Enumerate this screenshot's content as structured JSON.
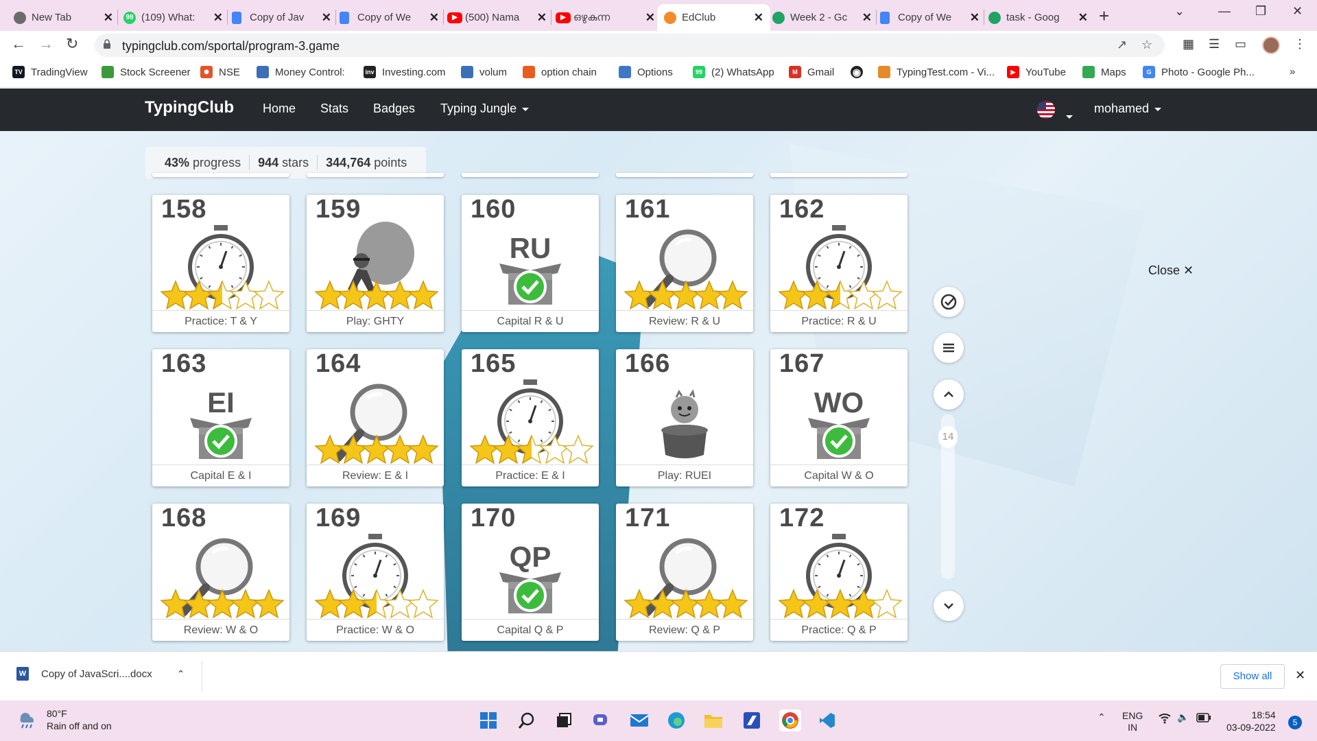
{
  "browser": {
    "tabs": [
      {
        "title": "New Tab",
        "icon": "chrome-icon",
        "color": "#6b6b6b"
      },
      {
        "title": "(109) What:",
        "icon": "whatsapp-icon",
        "color": "#25d366"
      },
      {
        "title": "Copy of Jav",
        "icon": "google-docs-icon",
        "color": "#4285f4"
      },
      {
        "title": "Copy of We",
        "icon": "google-docs-icon",
        "color": "#4285f4"
      },
      {
        "title": "(500) Nama",
        "icon": "youtube-icon",
        "color": "#ff0000"
      },
      {
        "title": "ഒഴുകുന്ന",
        "icon": "youtube-icon",
        "color": "#ff0000"
      },
      {
        "title": "EdClub",
        "icon": "edclub-icon",
        "color": "#f28c28"
      },
      {
        "title": "Week 2 - Gc",
        "icon": "google-drive-icon",
        "color": "#1fa463"
      },
      {
        "title": "Copy of We",
        "icon": "google-docs-icon",
        "color": "#4285f4"
      },
      {
        "title": "task - Goog",
        "icon": "google-drive-icon",
        "color": "#1fa463"
      }
    ],
    "active_tab": 6,
    "url": "typingclub.com/sportal/program-3.game",
    "bookmarks": [
      {
        "label": "TradingView",
        "icon": "tradingview-icon",
        "color": "#131722"
      },
      {
        "label": "Stock Screener",
        "icon": "bar-chart-icon",
        "color": "#3c9a3c"
      },
      {
        "label": "NSE",
        "icon": "nse-icon",
        "color": "#e2542b"
      },
      {
        "label": "Money Control:",
        "icon": "moneycontrol-icon",
        "color": "#3d6fb6"
      },
      {
        "label": "Investing.com",
        "icon": "investing-icon",
        "color": "#222222"
      },
      {
        "label": "volum",
        "icon": "volume-icon",
        "color": "#3d6fb6"
      },
      {
        "label": "option chain",
        "icon": "flame-icon",
        "color": "#e95b1f"
      },
      {
        "label": "Options",
        "icon": "options-icon",
        "color": "#3e77c8"
      },
      {
        "label": "(2) WhatsApp",
        "icon": "whatsapp-icon",
        "color": "#25d366"
      },
      {
        "label": "Gmail",
        "icon": "gmail-icon",
        "color": "#d93025"
      },
      {
        "label": "",
        "icon": "globe-icon",
        "color": "#222222"
      },
      {
        "label": "TypingTest.com - Vi...",
        "icon": "typingtest-icon",
        "color": "#e58a2b"
      },
      {
        "label": "YouTube",
        "icon": "youtube-icon",
        "color": "#ff0000"
      },
      {
        "label": "Maps",
        "icon": "maps-icon",
        "color": "#34a853"
      },
      {
        "label": "Photo - Google Ph...",
        "icon": "google-icon",
        "color": "#4285f4"
      }
    ]
  },
  "site": {
    "brand": "TypingClub",
    "nav": [
      "Home",
      "Stats",
      "Badges",
      "Typing Jungle"
    ],
    "user": "mohamed",
    "progress": {
      "percent": "43%",
      "percent_label": "progress",
      "stars": "944",
      "stars_label": "stars",
      "points": "344,764",
      "points_label": "points"
    },
    "close_label": "Close",
    "scroll_page": "14"
  },
  "lessons": [
    {
      "num": "158",
      "type": "stopwatch",
      "stars": 2.5,
      "label": "Practice: T & Y"
    },
    {
      "num": "159",
      "type": "play-balloon",
      "stars": 5,
      "label": "Play: GHTY"
    },
    {
      "num": "160",
      "type": "capital",
      "letters": "RU",
      "stars": 0,
      "label": "Capital R & U"
    },
    {
      "num": "161",
      "type": "magnifier",
      "stars": 5,
      "label": "Review: R & U"
    },
    {
      "num": "162",
      "type": "stopwatch",
      "stars": 2.5,
      "label": "Practice: R & U"
    },
    {
      "num": "163",
      "type": "capital",
      "letters": "EI",
      "stars": 0,
      "label": "Capital E & I"
    },
    {
      "num": "164",
      "type": "magnifier",
      "stars": 5,
      "label": "Review: E & I"
    },
    {
      "num": "165",
      "type": "stopwatch",
      "stars": 2.5,
      "label": "Practice: E & I"
    },
    {
      "num": "166",
      "type": "play-pot",
      "stars": 0,
      "label": "Play: RUEI"
    },
    {
      "num": "167",
      "type": "capital",
      "letters": "WO",
      "stars": 0,
      "label": "Capital W & O"
    },
    {
      "num": "168",
      "type": "magnifier",
      "stars": 5,
      "label": "Review: W & O"
    },
    {
      "num": "169",
      "type": "stopwatch",
      "stars": 2.5,
      "label": "Practice: W & O"
    },
    {
      "num": "170",
      "type": "capital",
      "letters": "QP",
      "stars": 0,
      "label": "Capital Q & P"
    },
    {
      "num": "171",
      "type": "magnifier",
      "stars": 5,
      "label": "Review: Q & P"
    },
    {
      "num": "172",
      "type": "stopwatch",
      "stars": 4,
      "label": "Practice: Q & P"
    }
  ],
  "download": {
    "filename": "Copy of JavaScri....docx",
    "show_all": "Show all"
  },
  "taskbar": {
    "temp": "80°F",
    "weather": "Rain off and on",
    "lang": "ENG",
    "region": "IN",
    "time": "18:54",
    "date": "03-09-2022",
    "notifications": "5"
  },
  "colors": {
    "nav_bg": "#262a2e",
    "star": "#f5c518",
    "check": "#3dbb3d"
  }
}
